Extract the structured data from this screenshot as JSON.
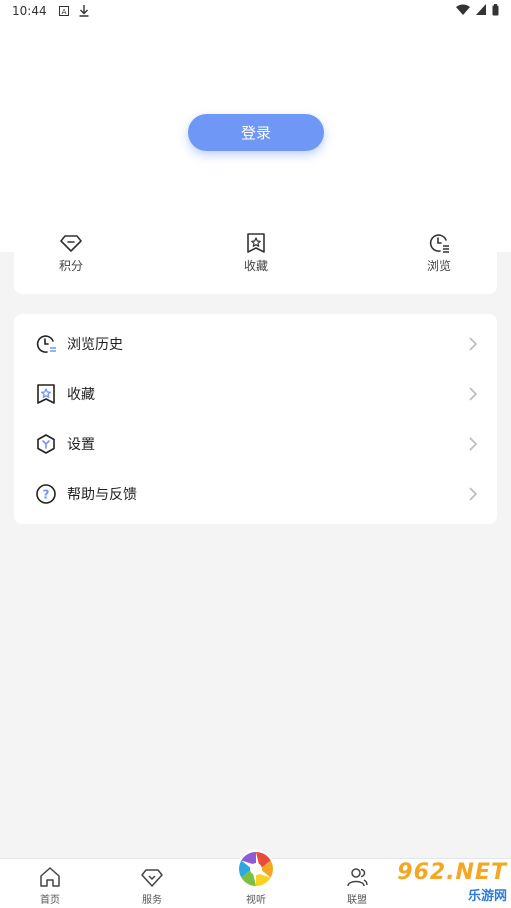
{
  "status_bar": {
    "time": "10:44",
    "left_icons": [
      "a-icon",
      "download-icon"
    ],
    "right_icons": [
      "wifi-icon",
      "signal-icon",
      "battery-icon"
    ]
  },
  "header": {
    "login_label": "登录",
    "accent_color": "#6e97f6"
  },
  "quick_links": [
    {
      "label": "积分",
      "icon": "diamond-icon"
    },
    {
      "label": "收藏",
      "icon": "bookmark-star-icon"
    },
    {
      "label": "浏览",
      "icon": "clock-list-icon"
    }
  ],
  "menu": [
    {
      "label": "浏览历史",
      "icon": "history-clock-icon"
    },
    {
      "label": "收藏",
      "icon": "bookmark-star-icon"
    },
    {
      "label": "设置",
      "icon": "settings-hexagon-icon"
    },
    {
      "label": "帮助与反馈",
      "icon": "help-circle-icon"
    }
  ],
  "tab_bar": [
    {
      "label": "首页",
      "icon": "home-icon"
    },
    {
      "label": "服务",
      "icon": "diamond-icon"
    },
    {
      "label": "视听",
      "icon": "aperture-icon"
    },
    {
      "label": "联盟",
      "icon": "users-icon"
    }
  ],
  "watermark": {
    "big": "962.NET",
    "small": "乐游网"
  }
}
